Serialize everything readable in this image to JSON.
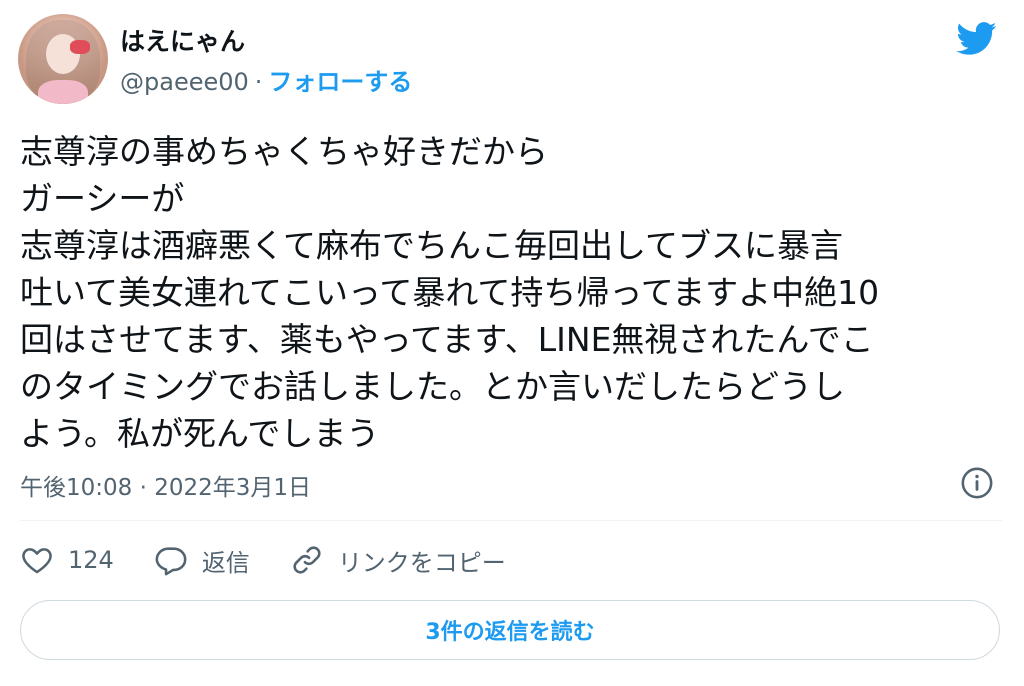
{
  "user": {
    "display_name": "はえにゃん",
    "handle": "@paeee00",
    "separator": "·",
    "follow_label": "フォローする"
  },
  "tweet": {
    "text": "志尊淳の事めちゃくちゃ好きだから\nガーシーが\n志尊淳は酒癖悪くて麻布でちんこ毎回出してブスに暴言\n吐いて美女連れてこいって暴れて持ち帰ってますよ中絶10\n回はさせてます、薬もやってます、LINE無視されたんでこ\nのタイミングでお話しました。とか言いだしたらどうし\nよう。私が死んでしまう",
    "timestamp": "午後10:08 · 2022年3月1日"
  },
  "actions": {
    "like_count": "124",
    "reply_label": "返信",
    "copy_link_label": "リンクをコピー"
  },
  "read_replies_label": "3件の返信を読む",
  "colors": {
    "accent": "#1d9bf0",
    "text": "#0f1419",
    "secondary": "#536471",
    "border": "#cfd9de"
  },
  "icons": {
    "brand": "twitter-bird-icon",
    "info": "info-icon",
    "like": "heart-icon",
    "reply": "speech-bubble-icon",
    "copy_link": "link-icon"
  }
}
